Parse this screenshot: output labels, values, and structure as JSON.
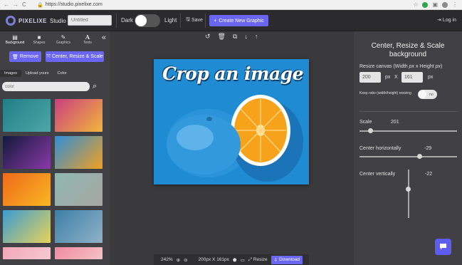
{
  "browser": {
    "url": "https://studio.pixelixe.com"
  },
  "topbar": {
    "logo_text": "PIXELIXE",
    "logo_studio": "Studio",
    "title_placeholder": "Untitled",
    "dark_label": "Dark",
    "light_label": "Light",
    "save_label": "Save",
    "create_label": "Create New Graphic",
    "login_label": "Log in"
  },
  "sidebar": {
    "tabs": [
      {
        "label": "Background",
        "icon": "image-icon"
      },
      {
        "label": "Shapes",
        "icon": "shapes-icon"
      },
      {
        "label": "Graphics",
        "icon": "graphics-icon"
      },
      {
        "label": "Texts",
        "icon": "text-icon"
      }
    ],
    "remove_label": "Remove",
    "center_label": "Center, Resize & Scale",
    "sub_tabs": [
      "Images",
      "Upload yours",
      "Color"
    ],
    "search_value": "color",
    "thumb_colors": [
      [
        "#1e7f86",
        "#4fa6a8"
      ],
      [
        "#c93f7e",
        "#f3b53b"
      ],
      [
        "#121a3b",
        "#8b39a8"
      ],
      [
        "#2e8fd8",
        "#f0a020"
      ],
      [
        "#f06a1a",
        "#f8b623"
      ],
      [
        "#8fb7b2",
        "#a8a6a0"
      ],
      [
        "#3a9bd1",
        "#e8d35a"
      ],
      [
        "#3d7fa6",
        "#8fb2c9"
      ],
      [
        "#f0a6b8",
        "#f7c9d1"
      ],
      [
        "#f08aa0",
        "#f4c2c8"
      ]
    ]
  },
  "canvas": {
    "title_text": "Crop an image",
    "zoom_label": "242%",
    "size_label": "200px X 161px",
    "resize_label": "Resize",
    "download_label": "Download"
  },
  "right_panel": {
    "title": "Center, Resize & Scale background",
    "resize_label_prefix": "Resize canvas (Width ",
    "resize_label_px1": "px",
    "resize_label_mid": " x Height ",
    "resize_label_px2": "px",
    "resize_label_suffix": ")",
    "width_value": "200",
    "height_value": "161",
    "px_label": "px",
    "x_label": "X",
    "keep_ratio_label": "Keep ratio (width/height) resizing",
    "keep_ratio_value": "no",
    "scale_label": "Scale",
    "scale_value": "201",
    "center_h_label": "Center horizontally",
    "center_h_value": "-29",
    "center_v_label": "Center vertically",
    "center_v_value": "-22"
  },
  "colors": {
    "accent": "#6b66f2",
    "panel": "#414145",
    "workspace": "#3a3a3c"
  }
}
